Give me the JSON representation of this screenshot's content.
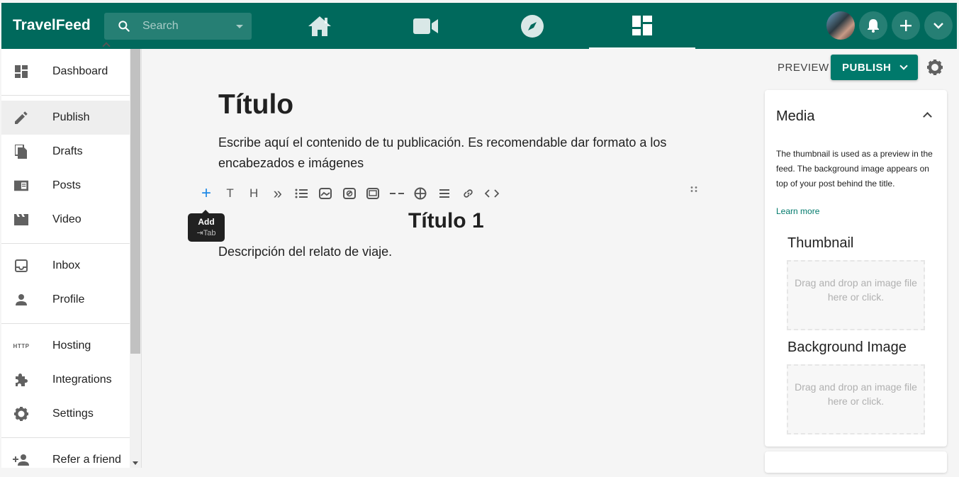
{
  "header": {
    "brand": "TravelFeed",
    "search_placeholder": "Search",
    "nav": [
      {
        "name": "home-icon"
      },
      {
        "name": "video-icon"
      },
      {
        "name": "compass-icon"
      },
      {
        "name": "dashboard-icon",
        "active": true
      }
    ]
  },
  "sidebar": {
    "items": [
      {
        "label": "Dashboard",
        "icon": "dashboard-icon"
      },
      {
        "label": "Publish",
        "icon": "pencil-icon",
        "active": true
      },
      {
        "label": "Drafts",
        "icon": "drafts-icon"
      },
      {
        "label": "Posts",
        "icon": "posts-icon"
      },
      {
        "label": "Video",
        "icon": "clapperboard-icon"
      },
      {
        "label": "Inbox",
        "icon": "inbox-icon"
      },
      {
        "label": "Profile",
        "icon": "person-icon"
      },
      {
        "label": "Hosting",
        "icon": "http-icon",
        "icon_text": "HTTP"
      },
      {
        "label": "Integrations",
        "icon": "puzzle-icon"
      },
      {
        "label": "Settings",
        "icon": "gear-icon"
      },
      {
        "label": "Refer a friend",
        "icon": "add-person-icon"
      }
    ]
  },
  "editor": {
    "title": "Título",
    "body": "Escribe aquí el contenido de tu publicación. Es recomendable dar formato a los encabezados e imágenes",
    "heading": "Título 1",
    "description": "Descripción del relato de viaje.",
    "toolbar": {
      "plus": "+",
      "text": "T",
      "heading": "H",
      "quote": "»",
      "tooltip_title": "Add",
      "tooltip_shortcut": "⇥Tab"
    }
  },
  "actions": {
    "preview": "PREVIEW",
    "publish": "PUBLISH"
  },
  "media": {
    "title": "Media",
    "description": "The thumbnail is used as a preview in the feed. The background image appears on top of your post behind the title.",
    "learn_more": "Learn more",
    "thumbnail_title": "Thumbnail",
    "thumbnail_drop": "Drag and drop an image file here or click.",
    "background_title": "Background Image",
    "background_drop": "Drag and drop an image file here or click."
  },
  "colors": {
    "primary": "#00695c",
    "accent": "#00796b",
    "background": "#f5f5f5"
  }
}
